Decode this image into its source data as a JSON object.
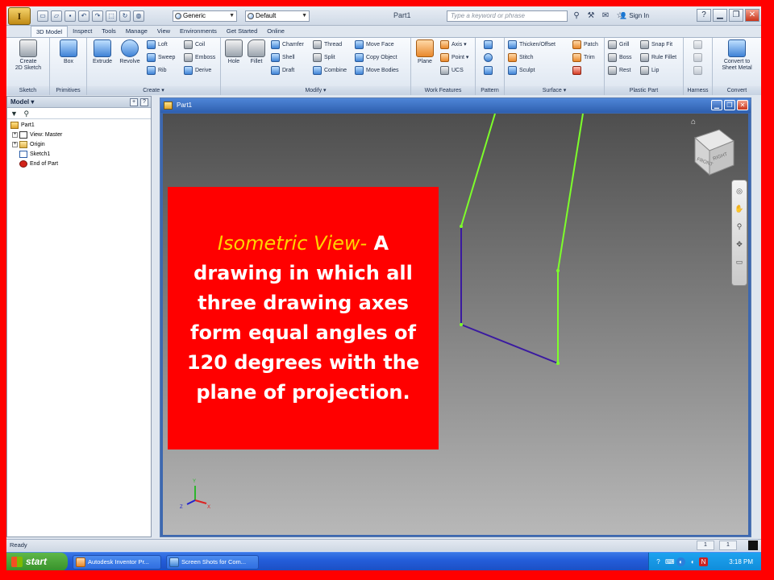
{
  "titlebar": {
    "app_logo": "I",
    "material": "Generic",
    "appearance": "Default",
    "document_title": "Part1",
    "search_placeholder": "Type a keyword or phrase",
    "sign_in": "Sign In",
    "help_icon": "?"
  },
  "tabs": [
    "3D Model",
    "Inspect",
    "Tools",
    "Manage",
    "View",
    "Environments",
    "Get Started",
    "Online"
  ],
  "ribbon": {
    "sketch": {
      "label": "Sketch",
      "create_2d_sketch": "Create\n2D Sketch"
    },
    "primitives": {
      "label": "Primitives",
      "box": "Box"
    },
    "create": {
      "label": "Create",
      "extrude": "Extrude",
      "revolve": "Revolve",
      "loft": "Loft",
      "sweep": "Sweep",
      "rib": "Rib",
      "coil": "Coil",
      "emboss": "Emboss",
      "derive": "Derive"
    },
    "modify": {
      "label": "Modify",
      "hole": "Hole",
      "fillet": "Fillet",
      "chamfer": "Chamfer",
      "shell": "Shell",
      "draft": "Draft",
      "thread": "Thread",
      "split": "Split",
      "combine": "Combine",
      "move_face": "Move Face",
      "copy_object": "Copy Object",
      "move_bodies": "Move Bodies"
    },
    "work_features": {
      "label": "Work Features",
      "plane": "Plane",
      "axis": "Axis",
      "point": "Point",
      "ucs": "UCS"
    },
    "pattern": {
      "label": "Pattern"
    },
    "surface": {
      "label": "Surface",
      "thicken_offset": "Thicken/Offset",
      "stitch": "Stitch",
      "sculpt": "Sculpt",
      "patch": "Patch",
      "trim": "Trim"
    },
    "plastic_part": {
      "label": "Plastic Part",
      "grill": "Grill",
      "boss": "Boss",
      "rest": "Rest",
      "snap_fit": "Snap Fit",
      "rule_fillet": "Rule Fillet",
      "lip": "Lip"
    },
    "harness": {
      "label": "Harness"
    },
    "convert": {
      "label": "Convert",
      "convert_to_sheet_metal": "Convert to\nSheet Metal"
    }
  },
  "browser": {
    "title": "Model",
    "tree": [
      {
        "label": "Part1",
        "icon": "part-icon",
        "indent": 0
      },
      {
        "label": "View: Master",
        "icon": "view-icon",
        "indent": 1
      },
      {
        "label": "Origin",
        "icon": "folder-icon",
        "indent": 1
      },
      {
        "label": "Sketch1",
        "icon": "sketch-icon",
        "indent": 1
      },
      {
        "label": "End of Part",
        "icon": "end-of-part-icon",
        "indent": 1
      }
    ]
  },
  "document": {
    "title": "Part1",
    "viewcube": {
      "front": "FRONT",
      "right": "RIGHT"
    },
    "sketch_colors": {
      "selected": "#7dff2a",
      "profile": "#3a1aa0"
    }
  },
  "overlay": {
    "term": "Isometric View-",
    "definition": "A drawing in which all three drawing axes form equal angles of 120 degrees with the plane of projection."
  },
  "status": {
    "text": "Ready",
    "count1": "1",
    "count2": "1"
  },
  "taskbar": {
    "start": "start",
    "tasks": [
      "Autodesk Inventor Pr...",
      "Screen Shots for Com..."
    ],
    "clock": "3:18 PM"
  }
}
